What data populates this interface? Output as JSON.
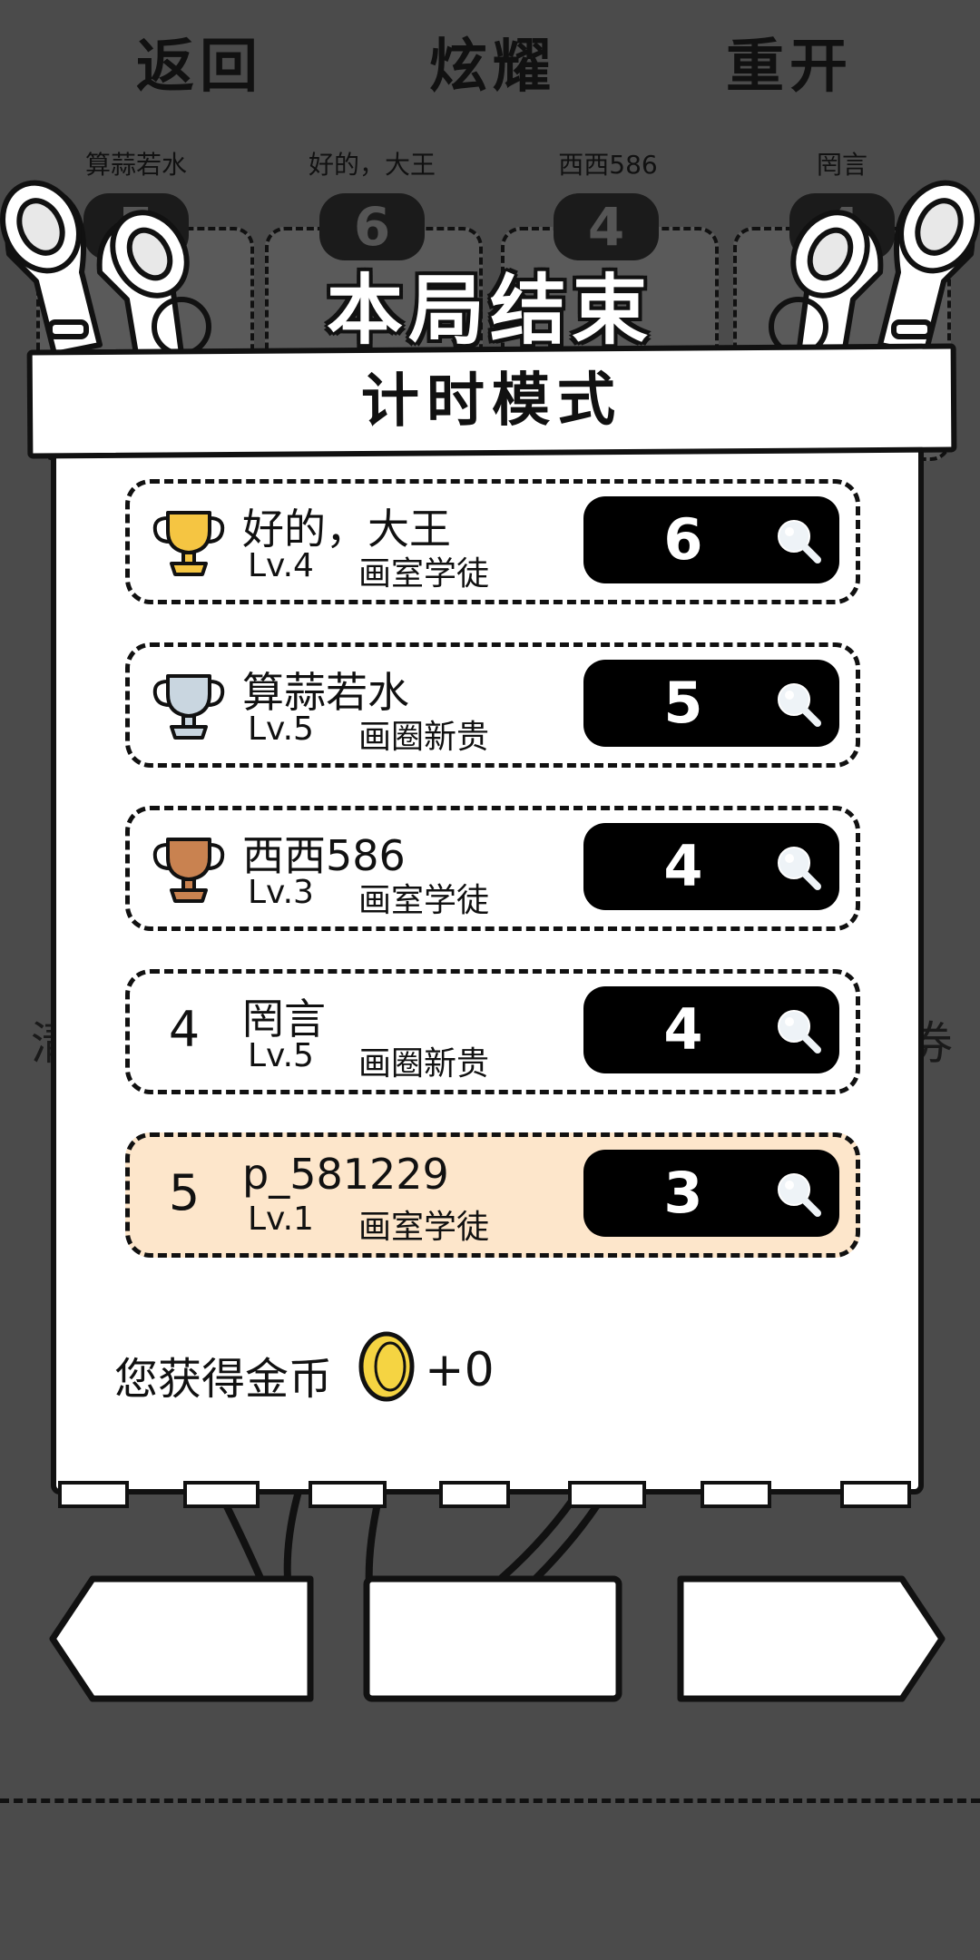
{
  "top_players": [
    {
      "name": "算蒜若水",
      "score": "5"
    },
    {
      "name": "好的，大王",
      "score": "6"
    },
    {
      "name": "西西586",
      "score": "4"
    },
    {
      "name": "罔言",
      "score": "4"
    }
  ],
  "title": "本局结束",
  "mode": "计时模式",
  "leaderboard": [
    {
      "rank": "1",
      "trophy": "gold-trophy-icon",
      "name": "好的，大王",
      "level": "Lv.4",
      "rank_title": "画室学徒",
      "score": "6"
    },
    {
      "rank": "2",
      "trophy": "silver-trophy-icon",
      "name": "算蒜若水",
      "level": "Lv.5",
      "rank_title": "画圈新贵",
      "score": "5"
    },
    {
      "rank": "3",
      "trophy": "bronze-trophy-icon",
      "name": "西西586",
      "level": "Lv.3",
      "rank_title": "画室学徒",
      "score": "4"
    },
    {
      "rank": "4",
      "trophy": "",
      "name": "罔言",
      "level": "Lv.5",
      "rank_title": "画圈新贵",
      "score": "4"
    },
    {
      "rank": "5",
      "trophy": "",
      "name": "p_581229",
      "level": "Lv.1",
      "rank_title": "画室学徒",
      "score": "3",
      "is_self": true
    }
  ],
  "reward": {
    "label": "您获得金币",
    "value": "+0"
  },
  "buttons": {
    "back": "返回",
    "show_off": "炫耀",
    "restart": "重开"
  },
  "side_left": "清",
  "side_right": "券",
  "colors": {
    "background": "#4b4b4b",
    "self_row": "#fde6cb",
    "gold": "#f5c542",
    "silver": "#c9d6e0",
    "bronze": "#c98250"
  }
}
